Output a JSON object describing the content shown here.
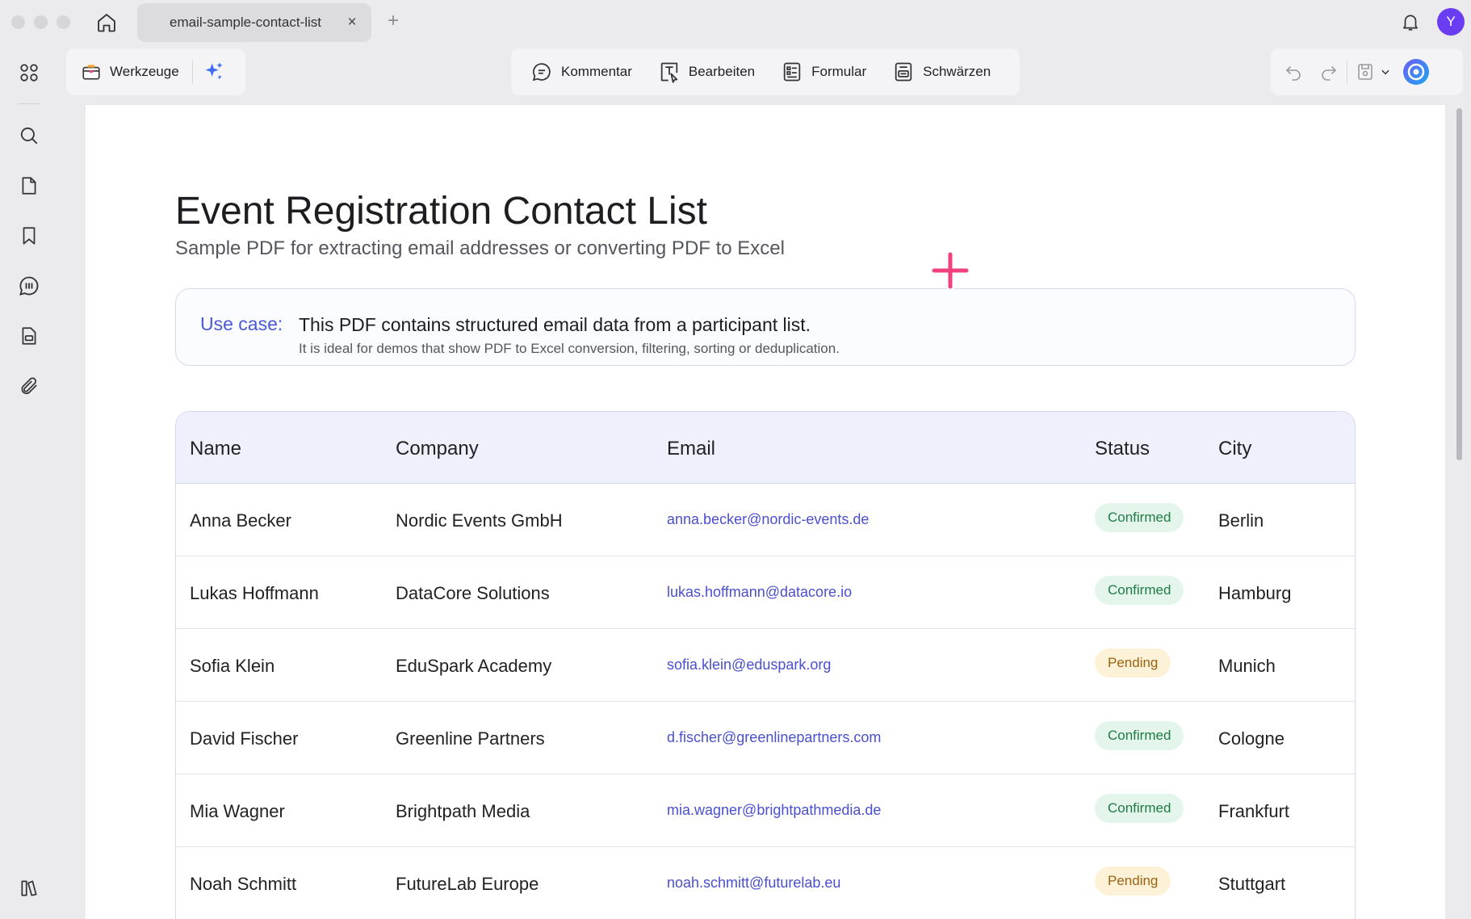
{
  "window": {
    "tab_title": "email-sample-contact-list",
    "tab_close": "×",
    "new_tab": "+",
    "avatar_initial": "Y"
  },
  "toolbar": {
    "tools_label": "Werkzeuge",
    "comment_label": "Kommentar",
    "edit_label": "Bearbeiten",
    "form_label": "Formular",
    "redact_label": "Schwärzen"
  },
  "document": {
    "title": "Event Registration Contact List",
    "subtitle": "Sample PDF for extracting email addresses or converting PDF to Excel",
    "use_case": {
      "label": "Use case:",
      "text": "This PDF contains structured email data from a participant list.",
      "note": "It is ideal for demos that show PDF to Excel conversion, filtering, sorting or deduplication."
    },
    "table": {
      "headers": [
        "Name",
        "Company",
        "Email",
        "Status",
        "City"
      ],
      "rows": [
        {
          "name": "Anna Becker",
          "company": "Nordic Events GmbH",
          "email": "anna.becker@nordic-events.de",
          "status": "Confirmed",
          "city": "Berlin"
        },
        {
          "name": "Lukas Hoffmann",
          "company": "DataCore Solutions",
          "email": "lukas.hoffmann@datacore.io",
          "status": "Confirmed",
          "city": "Hamburg"
        },
        {
          "name": "Sofia Klein",
          "company": "EduSpark Academy",
          "email": "sofia.klein@eduspark.org",
          "status": "Pending",
          "city": "Munich"
        },
        {
          "name": "David Fischer",
          "company": "Greenline Partners",
          "email": "d.fischer@greenlinepartners.com",
          "status": "Confirmed",
          "city": "Cologne"
        },
        {
          "name": "Mia Wagner",
          "company": "Brightpath Media",
          "email": "mia.wagner@brightpathmedia.de",
          "status": "Confirmed",
          "city": "Frankfurt"
        },
        {
          "name": "Noah Schmitt",
          "company": "FutureLab Europe",
          "email": "noah.schmitt@futurelab.eu",
          "status": "Pending",
          "city": "Stuttgart"
        }
      ]
    }
  },
  "colors": {
    "accent": "#4a59d6",
    "link": "#4a4fd0",
    "confirmed_bg": "#e4f6ec",
    "confirmed_text": "#1f7a46",
    "pending_bg": "#fdf1d8",
    "pending_text": "#9a6310",
    "cursor": "#f0407f"
  },
  "icons": [
    "home-icon",
    "close-icon",
    "plus-icon",
    "bell-icon",
    "apps-grid-icon",
    "search-icon",
    "page-icon",
    "bookmark-icon",
    "comments-icon",
    "document-icon",
    "attachment-icon",
    "sidebar-toggle-icon",
    "toolbox-icon",
    "ai-sparkle-icon",
    "comment-icon",
    "edit-icon",
    "form-icon",
    "redact-icon",
    "undo-icon",
    "redo-icon",
    "save-icon",
    "chevron-down-icon",
    "ai-assistant-icon"
  ]
}
